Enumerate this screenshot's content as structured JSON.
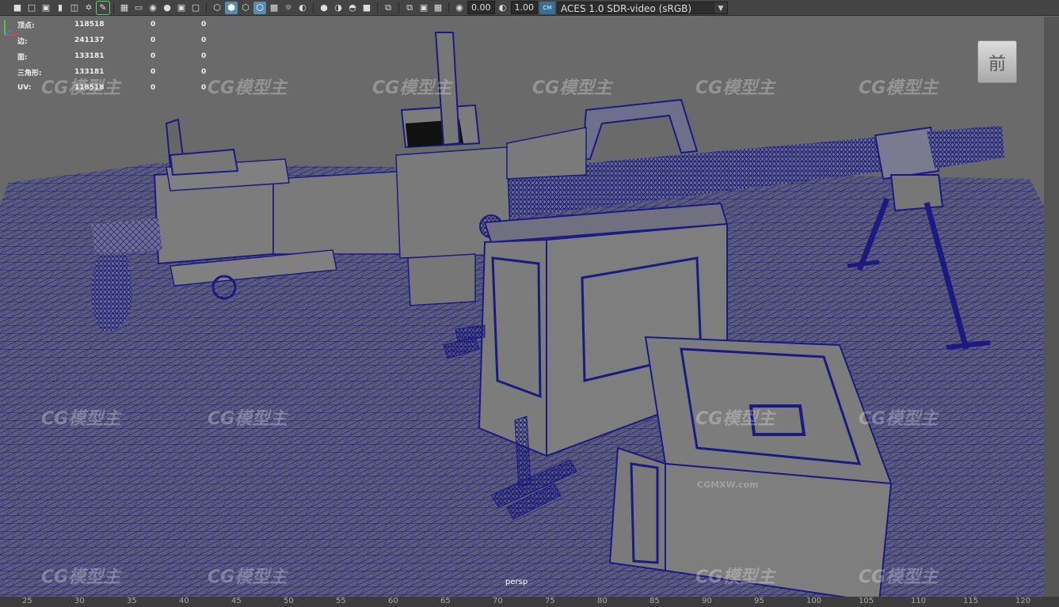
{
  "toolbar": {
    "exposure": "0.00",
    "gamma": "1.00",
    "color_management_badge": "CM",
    "color_space": "ACES 1.0 SDR-video (sRGB)"
  },
  "hud": {
    "rows": [
      {
        "label": "顶点:",
        "value": "118518",
        "c1": "0",
        "c2": "0"
      },
      {
        "label": "边:",
        "value": "241137",
        "c1": "0",
        "c2": "0"
      },
      {
        "label": "面:",
        "value": "133181",
        "c1": "0",
        "c2": "0"
      },
      {
        "label": "三角形:",
        "value": "133181",
        "c1": "0",
        "c2": "0"
      },
      {
        "label": "UV:",
        "value": "118518",
        "c1": "0",
        "c2": "0"
      }
    ]
  },
  "viewport": {
    "camera": "persp",
    "view_cube_label": "前",
    "watermark": "CG模型主",
    "watermark_url": "CGMXW.com"
  },
  "ruler": {
    "ticks": [
      "25",
      "30",
      "35",
      "40",
      "45",
      "50",
      "55",
      "60",
      "65",
      "70",
      "75",
      "80",
      "85",
      "90",
      "95",
      "100",
      "105",
      "110",
      "115",
      "120"
    ]
  },
  "colors": {
    "wire": "#1f1f8c",
    "surface": "#7c7c7c",
    "background": "#6a6a6a"
  }
}
